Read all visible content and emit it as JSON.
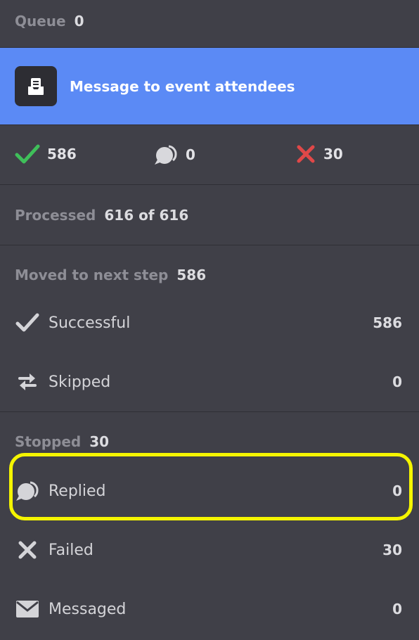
{
  "queue": {
    "label": "Queue",
    "value": "0"
  },
  "step": {
    "title": "Message to event attendees",
    "icon": "inbox-icon"
  },
  "stats": {
    "success": {
      "icon": "check-icon",
      "value": "586",
      "color": "#3fbf5a"
    },
    "replied": {
      "icon": "reply-bubble-icon",
      "value": "0"
    },
    "failed": {
      "icon": "cross-icon",
      "value": "30",
      "color": "#e04848"
    }
  },
  "processed": {
    "label": "Processed",
    "value": "616 of 616"
  },
  "moved": {
    "label": "Moved to next step",
    "value": "586",
    "rows": [
      {
        "label": "Successful",
        "value": "586",
        "icon": "check-icon"
      },
      {
        "label": "Skipped",
        "value": "0",
        "icon": "swap-arrows-icon"
      }
    ]
  },
  "stopped": {
    "label": "Stopped",
    "value": "30",
    "rows": [
      {
        "label": "Replied",
        "value": "0",
        "icon": "reply-bubble-icon"
      },
      {
        "label": "Failed",
        "value": "30",
        "icon": "cross-icon"
      },
      {
        "label": "Messaged",
        "value": "0",
        "icon": "envelope-icon"
      }
    ]
  },
  "highlight_color": "#f5f500"
}
